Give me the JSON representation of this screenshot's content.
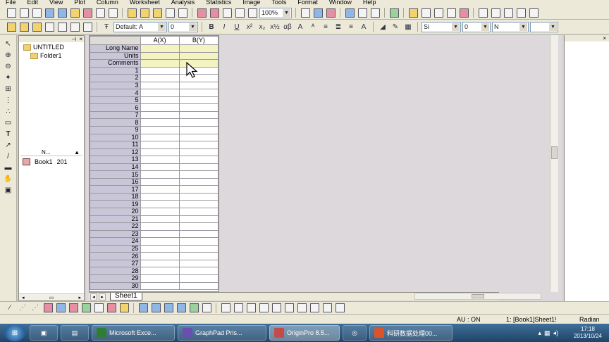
{
  "menu": [
    "File",
    "Edit",
    "View",
    "Plot",
    "Column",
    "Worksheet",
    "Analysis",
    "Statistics",
    "Image",
    "Tools",
    "Format",
    "Window",
    "Help"
  ],
  "toolbar1": {
    "zoom": "100%"
  },
  "toolbar2": {
    "font": "Default: A",
    "size": "0",
    "size2": "0",
    "line_combo": "Si",
    "combo_n": "N"
  },
  "explorer": {
    "root": "UNTITLED",
    "folder": "Folder1",
    "list_header": "N...",
    "items": [
      {
        "name": "Book1",
        "date": "201"
      }
    ]
  },
  "worksheet": {
    "columns": [
      "A(X)",
      "B(Y)"
    ],
    "label_rows": [
      "Long Name",
      "Units",
      "Comments"
    ],
    "row_numbers": [
      "1",
      "2",
      "3",
      "4",
      "5",
      "6",
      "7",
      "8",
      "9",
      "10",
      "11",
      "12",
      "13",
      "14",
      "15",
      "16",
      "17",
      "18",
      "19",
      "20",
      "21",
      "22",
      "23",
      "24",
      "25",
      "26",
      "27",
      "28",
      "29",
      "30"
    ],
    "sheet_tab": "Sheet1"
  },
  "statusbar": {
    "mode": "AU : ON",
    "active": "1: [Book1]Sheet1!",
    "angle": "Radian"
  },
  "taskbar": {
    "items": [
      {
        "label": "Microsoft Exce...",
        "color": "#2e7d32"
      },
      {
        "label": "GraphPad Pris...",
        "color": "#6a4fb3"
      },
      {
        "label": "OriginPro 8.5...",
        "color": "#c44b4b"
      },
      {
        "label": "科研数据处理00...",
        "color": "#d9542b"
      }
    ],
    "time": "17:18",
    "date": "2013/10/24"
  }
}
